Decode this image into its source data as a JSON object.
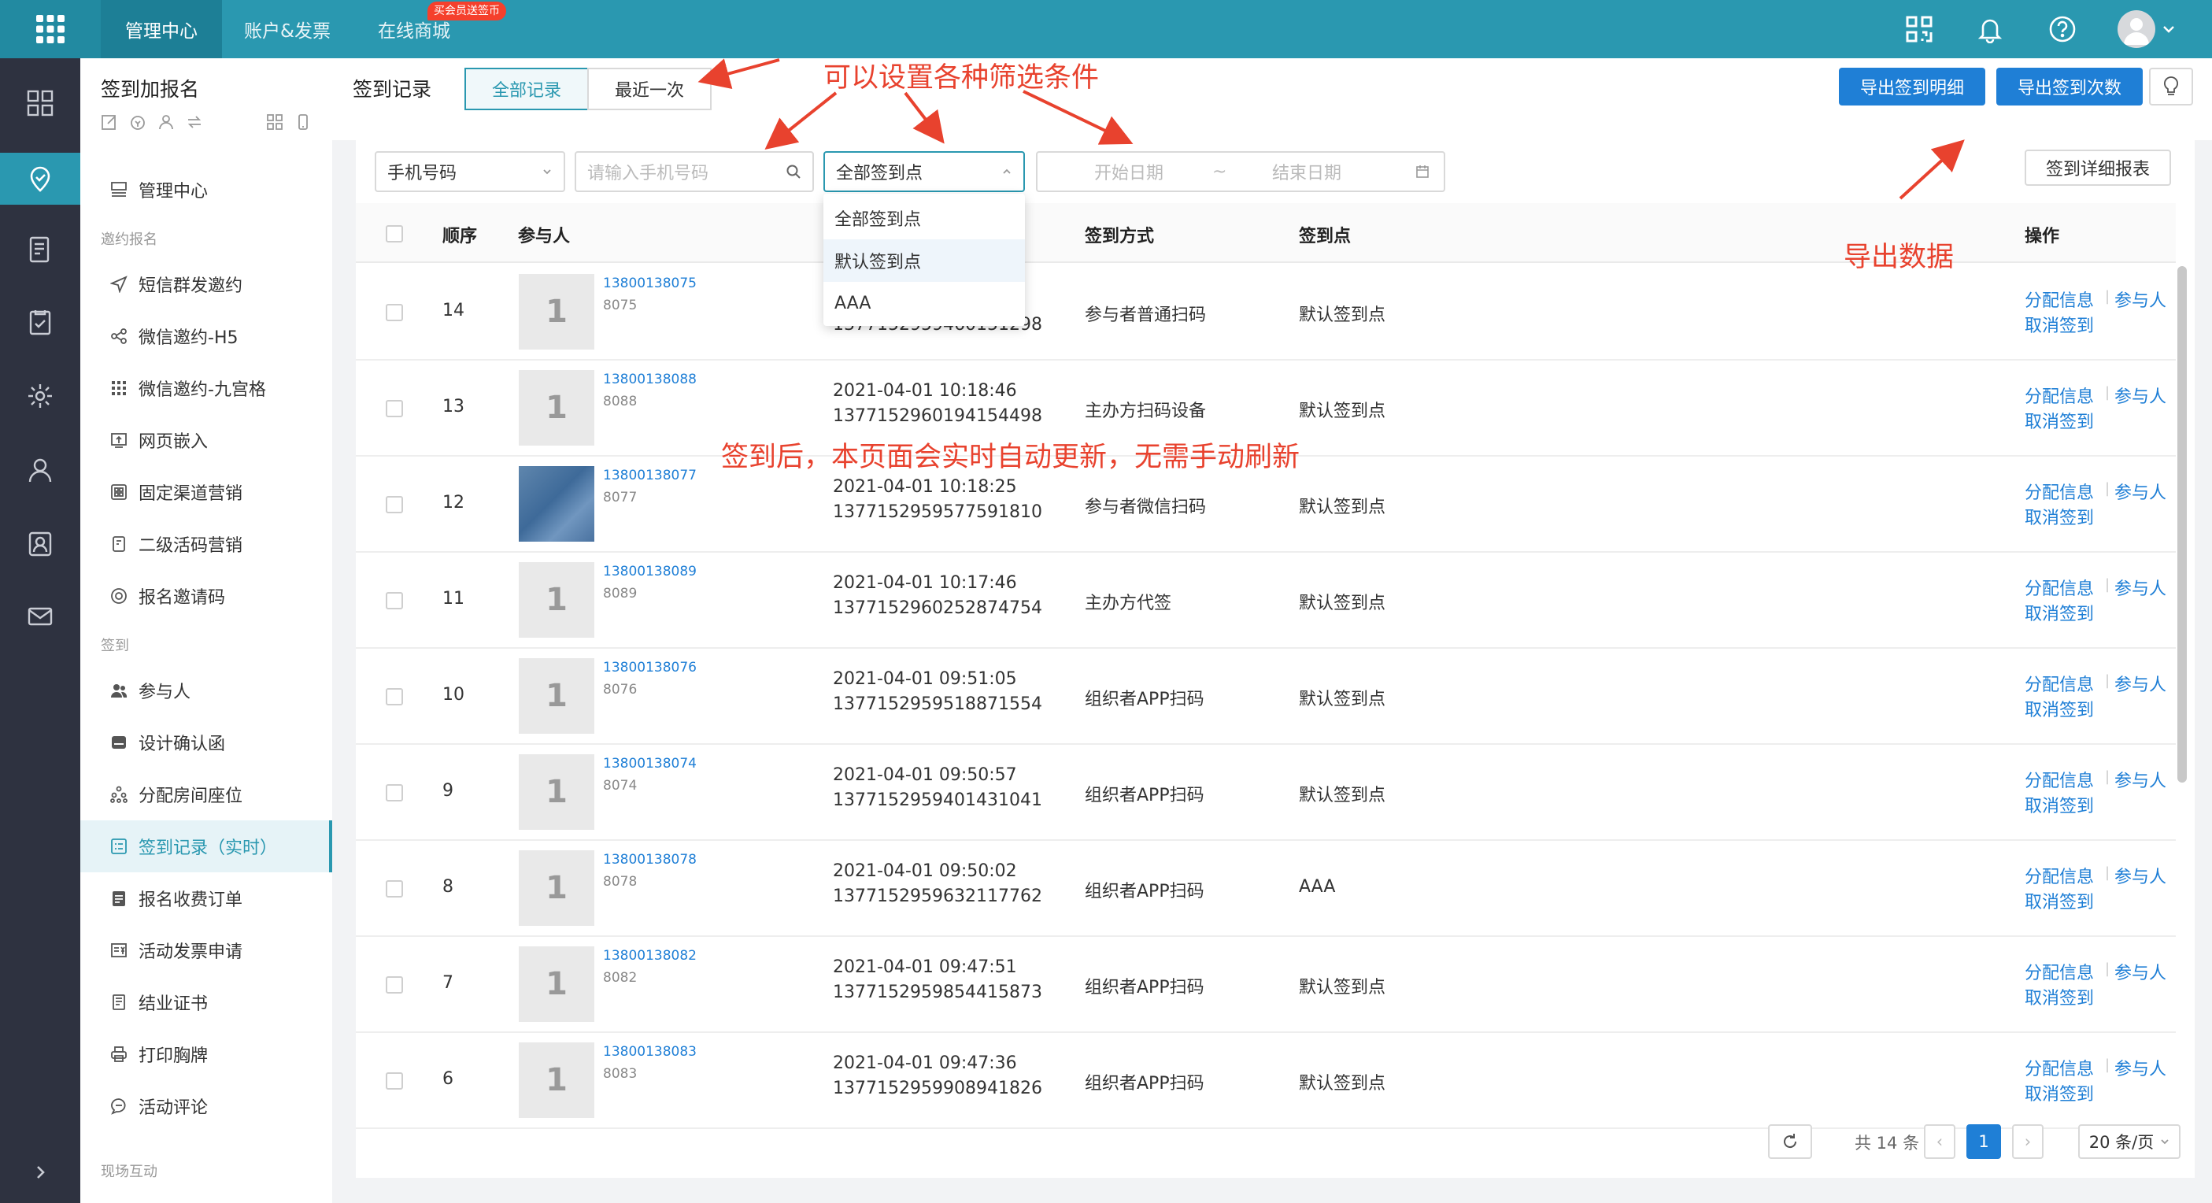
{
  "topbar": {
    "nav": [
      "管理中心",
      "账户&发票",
      "在线商城"
    ],
    "badge": "买会员送签币",
    "icons": [
      "apps-grid-icon",
      "qrcode-icon",
      "bell-icon",
      "help-icon",
      "user-avatar",
      "chevron-down-icon"
    ]
  },
  "sidebar": {
    "title": "签到加报名",
    "top_item": "管理中心",
    "groups": {
      "invite": "邀约报名",
      "checkin": "签到",
      "onsite": "现场互动"
    },
    "items": [
      "短信群发邀约",
      "微信邀约-H5",
      "微信邀约-九宫格",
      "网页嵌入",
      "固定渠道营销",
      "二级活码营销",
      "报名邀请码",
      "参与人",
      "设计确认函",
      "分配房间座位",
      "签到记录（实时）",
      "报名收费订单",
      "活动发票申请",
      "结业证书",
      "打印胸牌",
      "活动评论"
    ],
    "active": "签到记录（实时）"
  },
  "header": {
    "title": "签到记录",
    "tabs": [
      "全部记录",
      "最近一次"
    ],
    "active_tab": "全部记录",
    "export_detail": "导出签到明细",
    "export_count": "导出签到次数"
  },
  "filters": {
    "field_select": "手机号码",
    "phone_placeholder": "请输入手机号码",
    "point_select": "全部签到点",
    "start_placeholder": "开始日期",
    "range_sep": "~",
    "end_placeholder": "结束日期",
    "report_button": "签到详细报表",
    "point_options": [
      "全部签到点",
      "默认签到点",
      "AAA"
    ],
    "highlighted_option": "默认签到点"
  },
  "table": {
    "columns": [
      "顺序",
      "参与人",
      "签到方式",
      "签到点",
      "操作"
    ],
    "rows": [
      {
        "seq": "14",
        "avatar": "1",
        "phone": "13800138075",
        "code": "8075",
        "time": "",
        "id": "1377152959460151298",
        "method": "参与者普通扫码",
        "point": "默认签到点"
      },
      {
        "seq": "13",
        "avatar": "1",
        "phone": "13800138088",
        "code": "8088",
        "time": "2021-04-01 10:18:46",
        "id": "1377152960194154498",
        "method": "主办方扫码设备",
        "point": "默认签到点"
      },
      {
        "seq": "12",
        "avatar": "",
        "phone": "13800138077",
        "code": "8077",
        "time": "2021-04-01 10:18:25",
        "id": "1377152959577591810",
        "method": "参与者微信扫码",
        "point": "默认签到点"
      },
      {
        "seq": "11",
        "avatar": "1",
        "phone": "13800138089",
        "code": "8089",
        "time": "2021-04-01 10:17:46",
        "id": "1377152960252874754",
        "method": "主办方代签",
        "point": "默认签到点"
      },
      {
        "seq": "10",
        "avatar": "1",
        "phone": "13800138076",
        "code": "8076",
        "time": "2021-04-01 09:51:05",
        "id": "1377152959518871554",
        "method": "组织者APP扫码",
        "point": "默认签到点"
      },
      {
        "seq": "9",
        "avatar": "1",
        "phone": "13800138074",
        "code": "8074",
        "time": "2021-04-01 09:50:57",
        "id": "1377152959401431041",
        "method": "组织者APP扫码",
        "point": "默认签到点"
      },
      {
        "seq": "8",
        "avatar": "1",
        "phone": "13800138078",
        "code": "8078",
        "time": "2021-04-01 09:50:02",
        "id": "1377152959632117762",
        "method": "组织者APP扫码",
        "point": "AAA"
      },
      {
        "seq": "7",
        "avatar": "1",
        "phone": "13800138082",
        "code": "8082",
        "time": "2021-04-01 09:47:51",
        "id": "1377152959854415873",
        "method": "组织者APP扫码",
        "point": "默认签到点"
      },
      {
        "seq": "6",
        "avatar": "1",
        "phone": "13800138083",
        "code": "8083",
        "time": "2021-04-01 09:47:36",
        "id": "1377152959908941826",
        "method": "组织者APP扫码",
        "point": "默认签到点"
      }
    ],
    "actions": {
      "assign": "分配信息",
      "sep": "|",
      "participant": "参与人",
      "cancel": "取消签到"
    }
  },
  "pagination": {
    "total": "共 14 条",
    "current": "1",
    "prev": "‹",
    "next": "›",
    "page_size": "20 条/页"
  },
  "annotations": {
    "filters": "可以设置各种筛选条件",
    "export": "导出数据",
    "realtime": "签到后，本页面会实时自动更新，无需手动刷新"
  },
  "colors": {
    "brand": "#2a98b0",
    "primary_button": "#1f7fd6",
    "annotation": "#e8422e",
    "rail": "#2e3240"
  }
}
